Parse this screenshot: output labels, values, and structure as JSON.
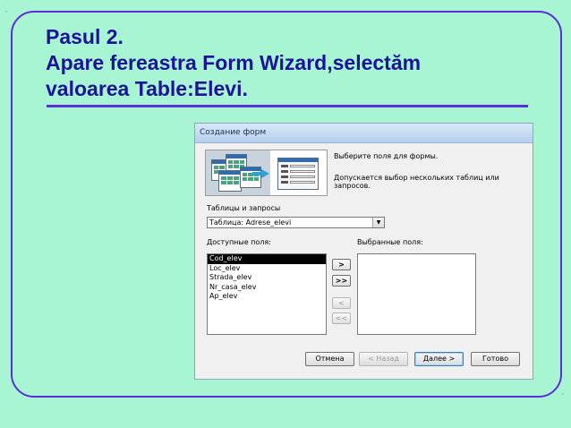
{
  "slide": {
    "title_lines": [
      "Pasul 2.",
      "Apare fereastra Form Wizard,selectăm",
      "valoarea Table:Elevi."
    ]
  },
  "dialog": {
    "title": "Создание форм",
    "instruction": "Выберите поля для формы.",
    "hint": "Допускается выбор нескольких таблиц или запросов.",
    "tables_label": "Таблицы и запросы",
    "table_value": "Таблица: Adrese_elevi",
    "available_label": "Доступные поля:",
    "selected_label": "Выбранные поля:",
    "available_fields": [
      "Cod_elev",
      "Loc_elev",
      "Strada_elev",
      "Nr_casa_elev",
      "Ap_elev"
    ],
    "selected_fields": [],
    "move_buttons": {
      "add_one": ">",
      "add_all": ">>",
      "remove_one": "<",
      "remove_all": "<<"
    },
    "buttons": {
      "cancel": "Отмена",
      "back": "< Назад",
      "next": "Далее >",
      "finish": "Готово"
    }
  },
  "colors": {
    "background": "#a8f5d4",
    "title": "#1c1399",
    "frame": "#5a2fd6"
  }
}
